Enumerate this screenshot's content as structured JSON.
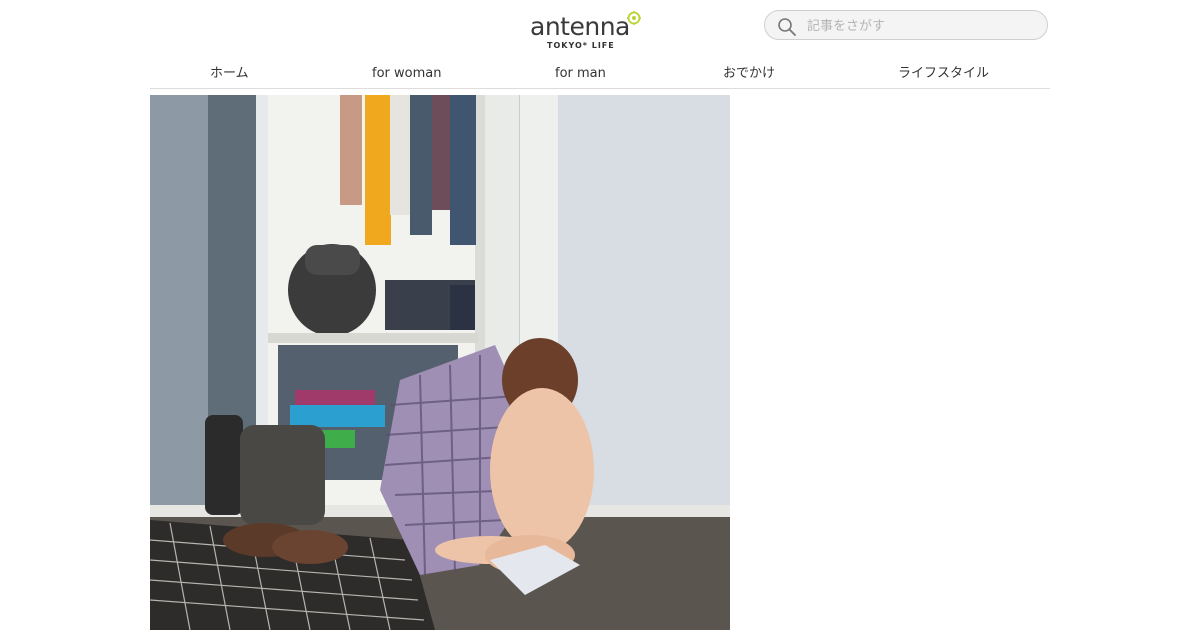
{
  "header": {
    "logo": {
      "wordmark": "antenna",
      "tagline": "TOKYO* LIFE"
    },
    "search": {
      "placeholder": "記事をさがす",
      "icon": "search-icon"
    }
  },
  "nav": {
    "items": [
      {
        "label": "ホーム"
      },
      {
        "label": "for woman"
      },
      {
        "label": "for man"
      },
      {
        "label": "おでかけ"
      },
      {
        "label": "ライフスタイル"
      }
    ]
  },
  "hero": {
    "image_subject": "toddler holding a plaid shirt in front of an open wardrobe"
  },
  "colors": {
    "logo_accent": "#b8d430",
    "text": "#333333",
    "divider": "#dddddd",
    "search_border": "#cfcfcf"
  }
}
